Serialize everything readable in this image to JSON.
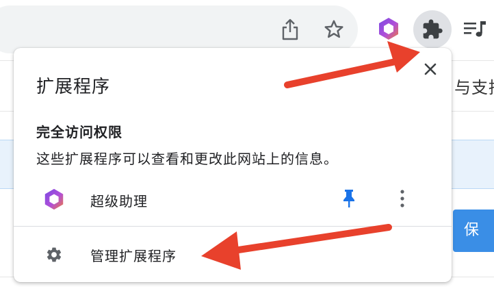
{
  "toolbar": {
    "icons": [
      "share-icon",
      "star-icon",
      "extension-logo-icon",
      "puzzle-icon",
      "media-queue-icon"
    ]
  },
  "background_page": {
    "partial_link_text": "与支持",
    "save_button_label": "保 存"
  },
  "popup": {
    "title": "扩展程序",
    "close_icon": "close-icon",
    "section_heading": "完全访问权限",
    "section_description": "这些扩展程序可以查看和更改此网站上的信息。",
    "extensions": [
      {
        "name": "超级助理",
        "icon": "hexagon-logo-icon",
        "pin_icon": "pin-icon",
        "more_icon": "more-vert-icon"
      }
    ],
    "manage_label": "管理扩展程序",
    "manage_icon": "gear-icon"
  },
  "colors": {
    "popup_bg": "#ffffff",
    "pin_blue": "#1a73e8",
    "save_button_blue": "#3a8ee6",
    "annotation_red": "#e8412c",
    "puzzle_button_bg": "#dfe1e5",
    "highlight_row_bg": "#e8f2fc"
  }
}
